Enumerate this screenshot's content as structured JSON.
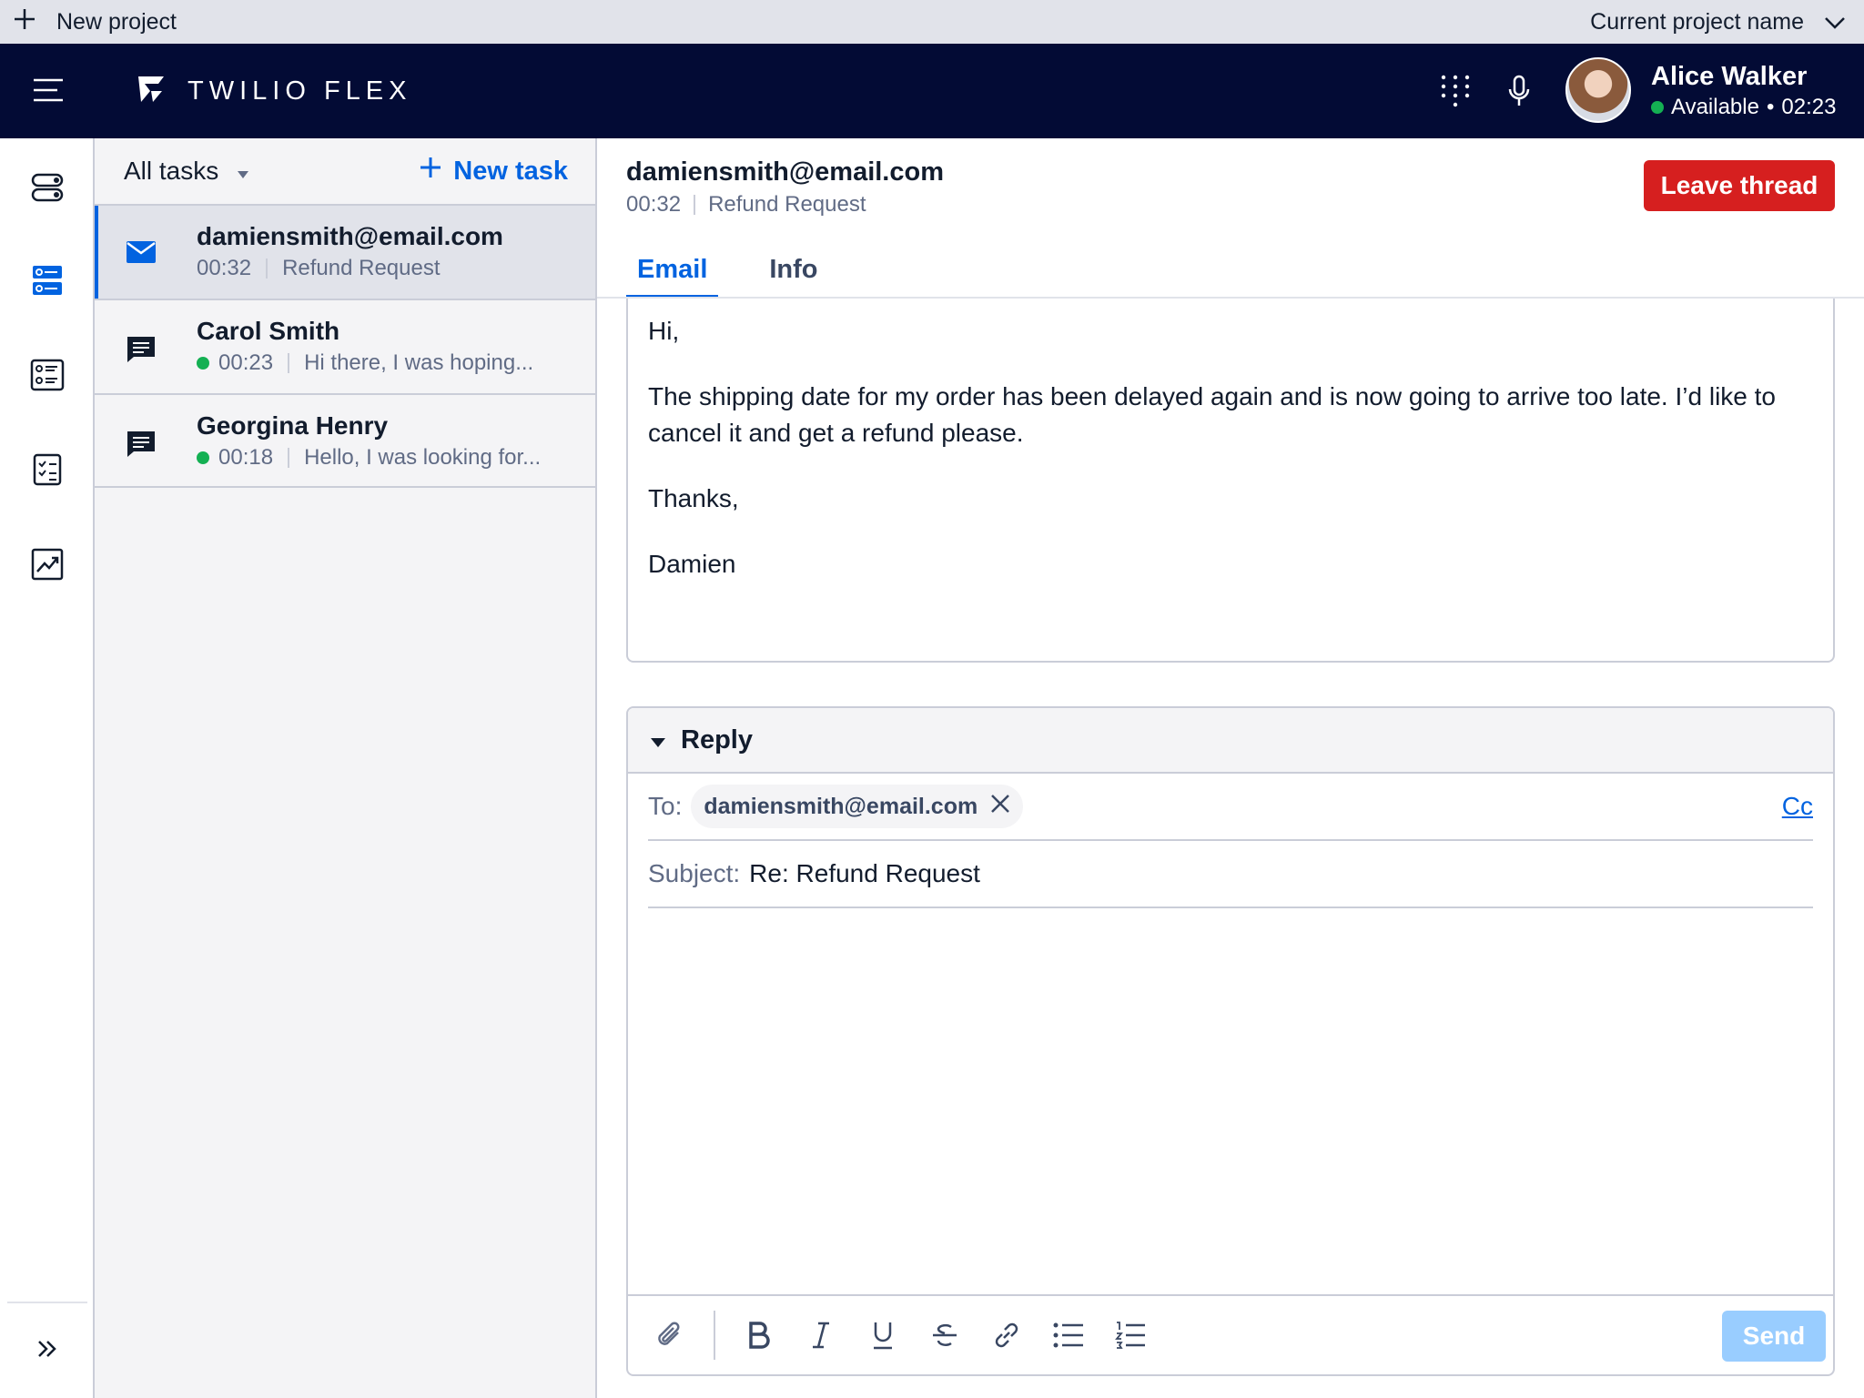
{
  "project_bar": {
    "new_project": "New project",
    "current_project": "Current project name"
  },
  "topnav": {
    "brand": "TWILIO FLEX",
    "user": {
      "name": "Alice Walker",
      "status": "Available",
      "time": "02:23"
    }
  },
  "tasklist": {
    "filter": "All tasks",
    "new_task": "New task",
    "tasks": [
      {
        "title": "damiensmith@email.com",
        "timer": "00:32",
        "preview": "Refund Request",
        "channel": "email-icon"
      },
      {
        "title": "Carol Smith",
        "timer": "00:23",
        "preview": "Hi there, I was hoping...",
        "channel": "chat-icon"
      },
      {
        "title": "Georgina Henry",
        "timer": "00:18",
        "preview": "Hello, I was looking for...",
        "channel": "chat-icon"
      }
    ]
  },
  "main": {
    "title": "damiensmith@email.com",
    "timer": "00:32",
    "subject": "Refund Request",
    "leave_button": "Leave thread",
    "tabs": [
      "Email",
      "Info"
    ],
    "email": {
      "greeting": "Hi,",
      "body": "The shipping date for my order has been delayed again and is now going to arrive too late. I’d like to cancel it and get a refund please.",
      "signoff": "Thanks,",
      "name": "Damien"
    },
    "reply": {
      "title": "Reply",
      "to_label": "To:",
      "to_chip": "damiensmith@email.com",
      "cc": "Cc",
      "subject_label": "Subject:",
      "subject_value": "Re: Refund Request",
      "send": "Send"
    }
  },
  "colors": {
    "nav": "#030b35",
    "accent": "#0263e0",
    "danger": "#d61f1f",
    "available": "#14b053",
    "send_disabled": "#99cdff"
  }
}
